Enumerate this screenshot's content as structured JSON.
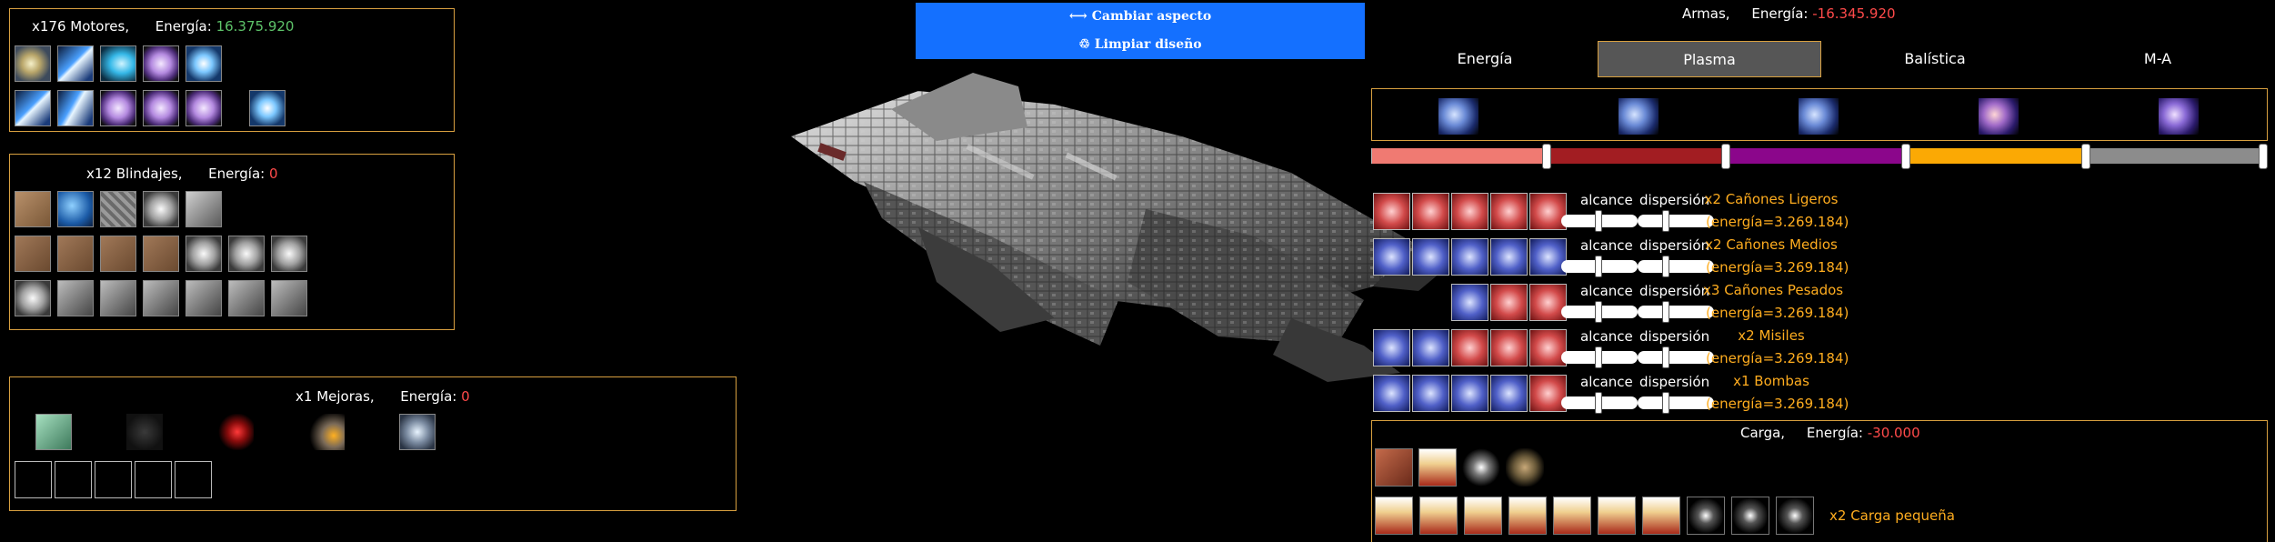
{
  "engines": {
    "count_label": "x176 Motores,",
    "energy_label": "Energía:",
    "energy_value": "16.375.920"
  },
  "armor": {
    "count_label": "x12 Blindajes,",
    "energy_label": "Energía:",
    "energy_value": "0"
  },
  "upgrades": {
    "count_label": "x1 Mejoras,",
    "energy_label": "Energía:",
    "energy_value": "0"
  },
  "design": {
    "change_look": "⟷ Cambiar aspecto",
    "clear_design": "♲ Limpiar diseño"
  },
  "weapons": {
    "header_label": "Armas,",
    "energy_label": "Energía:",
    "energy_value": "-16.345.920",
    "tabs": [
      "Energía",
      "Plasma",
      "Balística",
      "M-A"
    ],
    "active_tab": "Plasma",
    "rows": [
      {
        "name": "x2 Cañones Ligeros",
        "energy": "(energía=3.269.184)",
        "range_label": "alcance",
        "spread_label": "dispersión"
      },
      {
        "name": "x2 Cañones Medios",
        "energy": "(energía=3.269.184)",
        "range_label": "alcance",
        "spread_label": "dispersión"
      },
      {
        "name": "x3 Cañones Pesados",
        "energy": "(energía=3.269.184)",
        "range_label": "alcance",
        "spread_label": "dispersión"
      },
      {
        "name": "x2 Misiles",
        "energy": "(energía=3.269.184)",
        "range_label": "alcance",
        "spread_label": "dispersión"
      },
      {
        "name": "x1 Bombas",
        "energy": "(energía=3.269.184)",
        "range_label": "alcance",
        "spread_label": "dispersión"
      }
    ]
  },
  "cargo": {
    "header_label": "Carga,",
    "energy_label": "Energía:",
    "energy_value": "-30.000",
    "small_cargo_label": "x2 Carga pequeña"
  },
  "colors": {
    "accent_border": "#d8a040",
    "button_blue": "#1470ff",
    "energy_positive": "#5ec46a",
    "energy_negative": "#ff4a4a",
    "weapon_text": "#ffad1f"
  }
}
